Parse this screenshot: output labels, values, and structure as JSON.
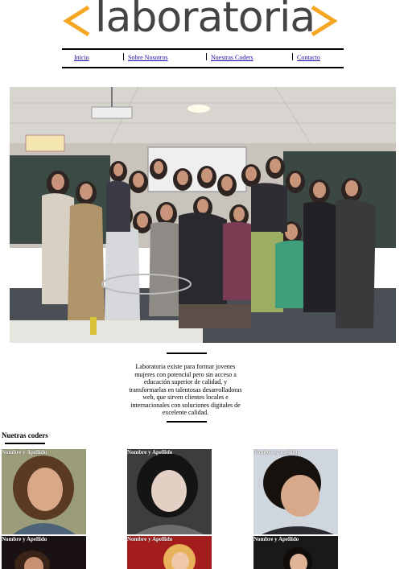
{
  "logo": {
    "text": "laboratoria"
  },
  "nav": {
    "items": [
      "Inicio",
      "Sobre Nosotros",
      "Nuestras Coders",
      "Contacto"
    ],
    "separator": "|"
  },
  "intro": {
    "text": "Laboratoria existe para formar jovenes mujeres con potencial pero sin acceso a educación superior de calidad, y transformarlas en talentosas desarrolladoras web, que sirven clientes locales e internacionales con soluciones digitales de excelente calidad."
  },
  "coders": {
    "title": "Nuetras coders",
    "cards": [
      {
        "name": "Nombre y Apellido"
      },
      {
        "name": "Nombre y Apellido"
      },
      {
        "name": "Nombre y Apellido"
      },
      {
        "name": "Nombre y Apellido"
      },
      {
        "name": "Nombre y Apellido"
      },
      {
        "name": "Nombre y Apellido"
      }
    ]
  },
  "colors": {
    "accent": "#f5a623",
    "logo_text": "#444444",
    "link": "#1a0dab"
  }
}
